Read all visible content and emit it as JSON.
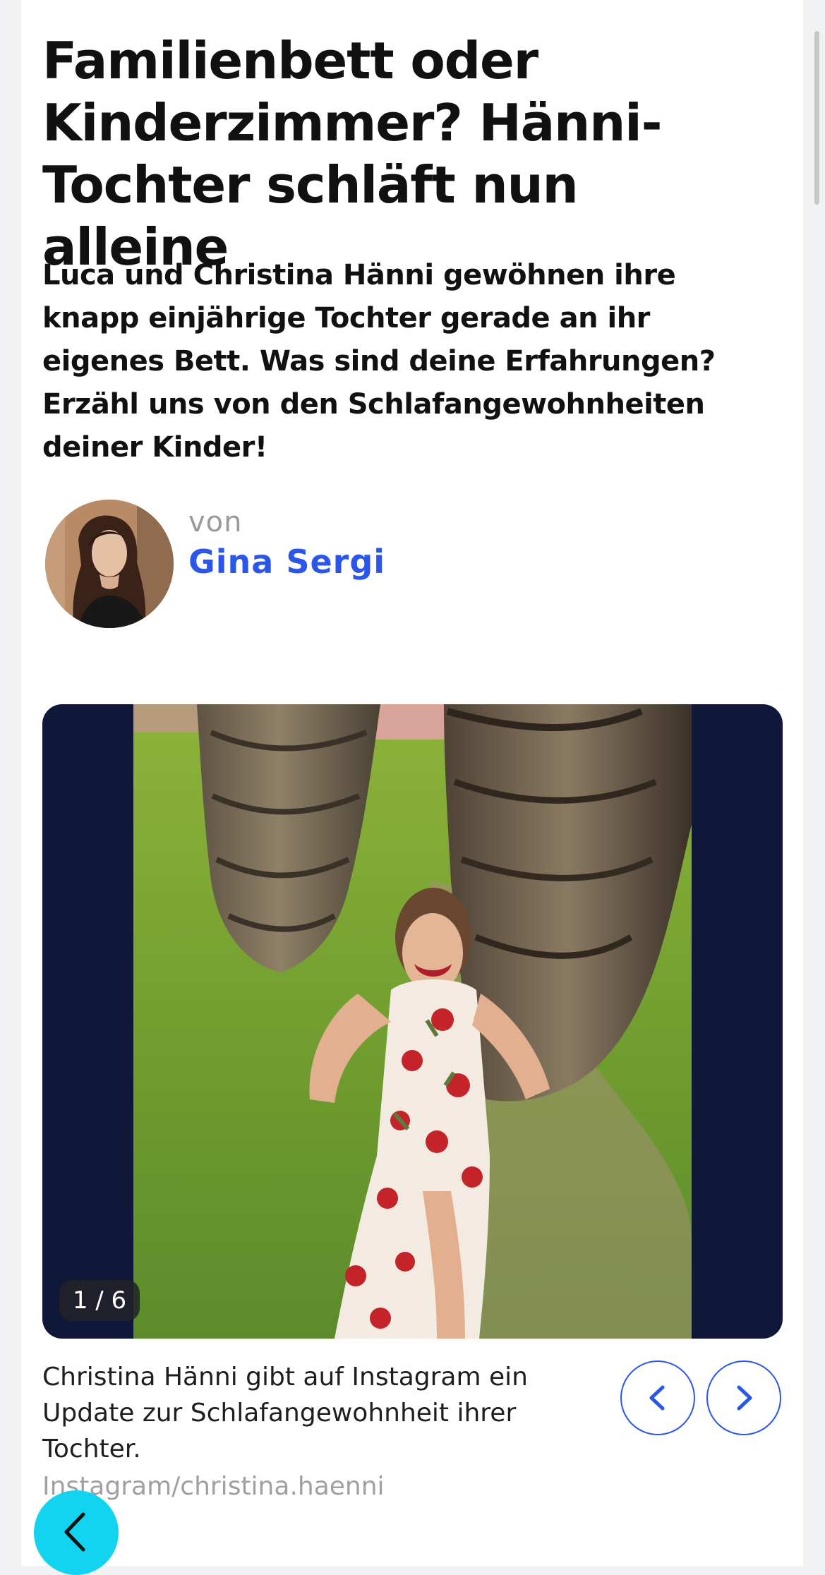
{
  "article": {
    "title": "Familienbett oder Kinderzimmer? Hänni-Tochter schläft nun alleine",
    "lead": "Luca und Christina Hänni gewöhnen ihre knapp einjährige Tochter gerade an ihr eigenes Bett. Was sind deine Erfahrungen? Erzähl uns von den Schlafangewohnheiten deiner Kinder!"
  },
  "author": {
    "by_label": "von",
    "name": "Gina Sergi"
  },
  "gallery": {
    "counter": "1 / 6",
    "caption": "Christina Hänni gibt auf Instagram ein Update zur Schlafangewohnheit ihrer Tochter.",
    "credit": "Instagram/christina.haenni",
    "prev_icon": "chevron-left-icon",
    "next_icon": "chevron-right-icon"
  },
  "back_button": {
    "icon": "chevron-left-icon"
  },
  "colors": {
    "accent": "#2a57ea",
    "gallery_background": "#0f1838",
    "back_button": "#12d3f0"
  }
}
